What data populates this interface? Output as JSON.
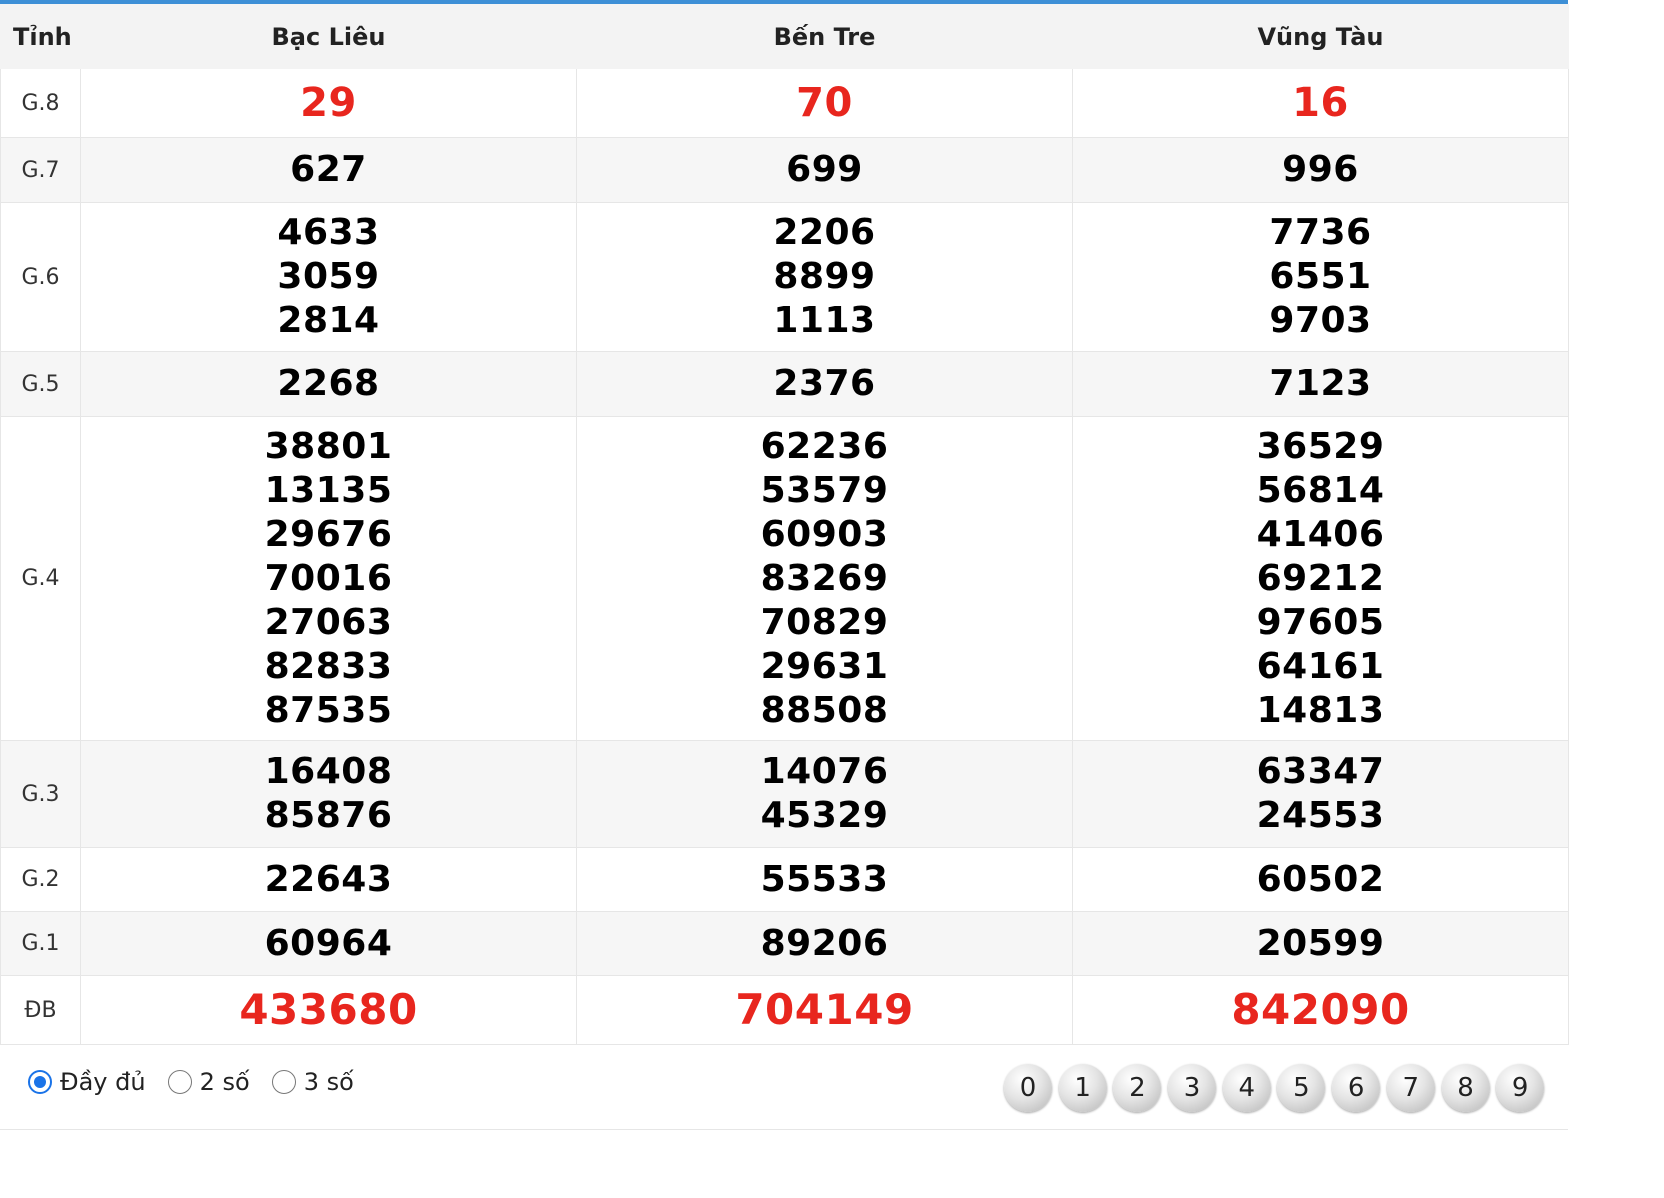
{
  "header": {
    "label": "Tỉnh",
    "provinces": [
      "Bạc Liêu",
      "Bến Tre",
      "Vũng Tàu"
    ]
  },
  "prizes": [
    {
      "label": "G.8",
      "values": [
        [
          "29"
        ],
        [
          "70"
        ],
        [
          "16"
        ]
      ]
    },
    {
      "label": "G.7",
      "values": [
        [
          "627"
        ],
        [
          "699"
        ],
        [
          "996"
        ]
      ]
    },
    {
      "label": "G.6",
      "values": [
        [
          "4633",
          "3059",
          "2814"
        ],
        [
          "2206",
          "8899",
          "1113"
        ],
        [
          "7736",
          "6551",
          "9703"
        ]
      ]
    },
    {
      "label": "G.5",
      "values": [
        [
          "2268"
        ],
        [
          "2376"
        ],
        [
          "7123"
        ]
      ]
    },
    {
      "label": "G.4",
      "values": [
        [
          "38801",
          "13135",
          "29676",
          "70016",
          "27063",
          "82833",
          "87535"
        ],
        [
          "62236",
          "53579",
          "60903",
          "83269",
          "70829",
          "29631",
          "88508"
        ],
        [
          "36529",
          "56814",
          "41406",
          "69212",
          "97605",
          "64161",
          "14813"
        ]
      ]
    },
    {
      "label": "G.3",
      "values": [
        [
          "16408",
          "85876"
        ],
        [
          "14076",
          "45329"
        ],
        [
          "63347",
          "24553"
        ]
      ]
    },
    {
      "label": "G.2",
      "values": [
        [
          "22643"
        ],
        [
          "55533"
        ],
        [
          "60502"
        ]
      ]
    },
    {
      "label": "G.1",
      "values": [
        [
          "60964"
        ],
        [
          "89206"
        ],
        [
          "20599"
        ]
      ]
    },
    {
      "label": "ĐB",
      "values": [
        [
          "433680"
        ],
        [
          "704149"
        ],
        [
          "842090"
        ]
      ]
    }
  ],
  "options": {
    "full": "Đầy đủ",
    "two": "2 số",
    "three": "3 số",
    "selected": "full"
  },
  "digits": [
    "0",
    "1",
    "2",
    "3",
    "4",
    "5",
    "6",
    "7",
    "8",
    "9"
  ],
  "colors": {
    "accent": "#3d8fd6",
    "highlight": "#e8261e",
    "radio": "#1a73e8"
  }
}
